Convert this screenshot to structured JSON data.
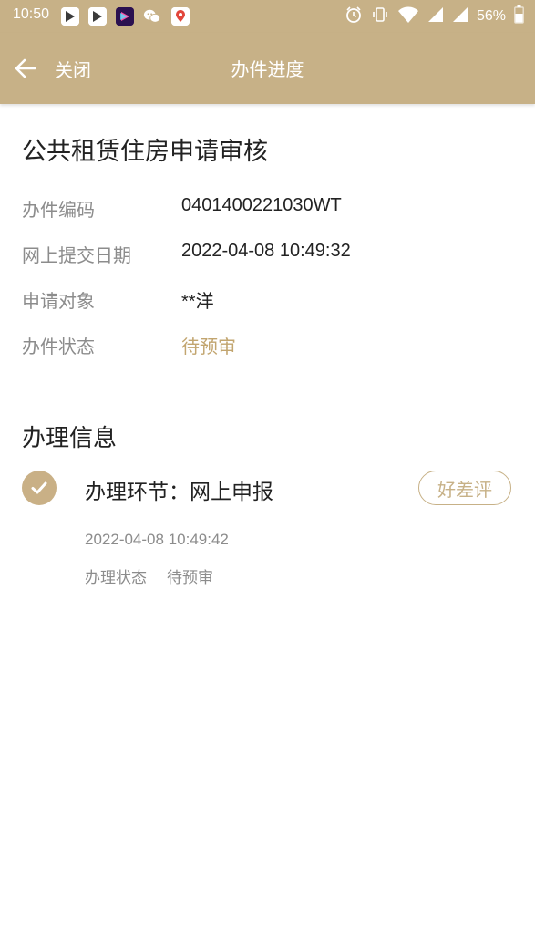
{
  "status_bar": {
    "time": "10:50",
    "battery_percent": "56%",
    "icons": [
      "app-icon-1",
      "app-icon-2",
      "app-icon-3",
      "wechat-icon",
      "maps-icon",
      "alarm-icon",
      "vibrate-icon",
      "wifi-icon",
      "signal-icon",
      "signal-icon-2",
      "battery-icon"
    ]
  },
  "header": {
    "close_label": "关闭",
    "title": "办件进度",
    "background_color": "#c7b187"
  },
  "application": {
    "title": "公共租赁住房申请审核",
    "fields": [
      {
        "label": "办件编码",
        "value": "0401400221030WT"
      },
      {
        "label": "网上提交日期",
        "value": "2022-04-08 10:49:32"
      },
      {
        "label": "申请对象",
        "value": "**洋"
      },
      {
        "label": "办件状态",
        "value": "待预审"
      }
    ],
    "status_color": "#c2a56f"
  },
  "processing": {
    "section_title": "办理信息",
    "steps": [
      {
        "title": "办理环节：网上申报",
        "rate_button_label": "好差评",
        "time": "2022-04-08 10:49:42",
        "status_label": "办理状态",
        "status_value": "待预审"
      }
    ]
  }
}
